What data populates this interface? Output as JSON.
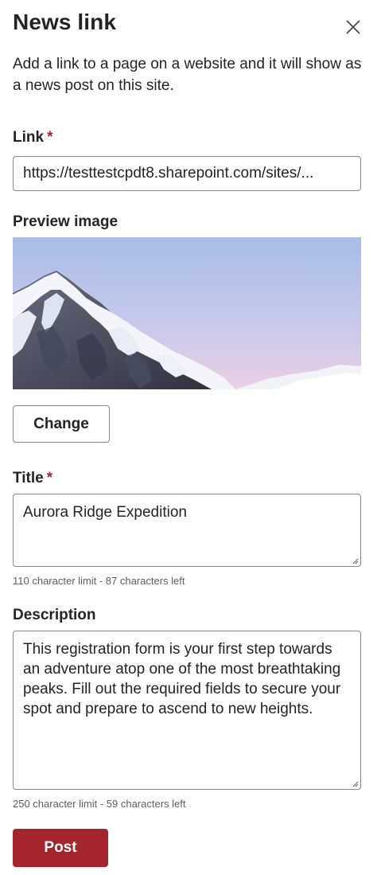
{
  "panel": {
    "title": "News link",
    "intro": "Add a link to a page on a website and it will show as a news post on this site."
  },
  "link": {
    "label": "Link",
    "required_mark": "*",
    "value": "https://testtestcpdt8.sharepoint.com/sites/..."
  },
  "preview": {
    "label": "Preview image",
    "change_label": "Change"
  },
  "title_field": {
    "label": "Title",
    "required_mark": "*",
    "value": "Aurora Ridge Expedition",
    "helper": "110 character limit - 87 characters left"
  },
  "description_field": {
    "label": "Description",
    "value": "This registration form is your first step towards an adventure atop one of the most breathtaking peaks. Fill out the required fields to secure your spot and prepare to ascend to new heights.",
    "helper": "250 character limit - 59 characters left"
  },
  "actions": {
    "post_label": "Post"
  },
  "colors": {
    "accent": "#a4262c",
    "text": "#242424",
    "border": "#8a8886"
  },
  "icons": {
    "close": "close-icon"
  }
}
